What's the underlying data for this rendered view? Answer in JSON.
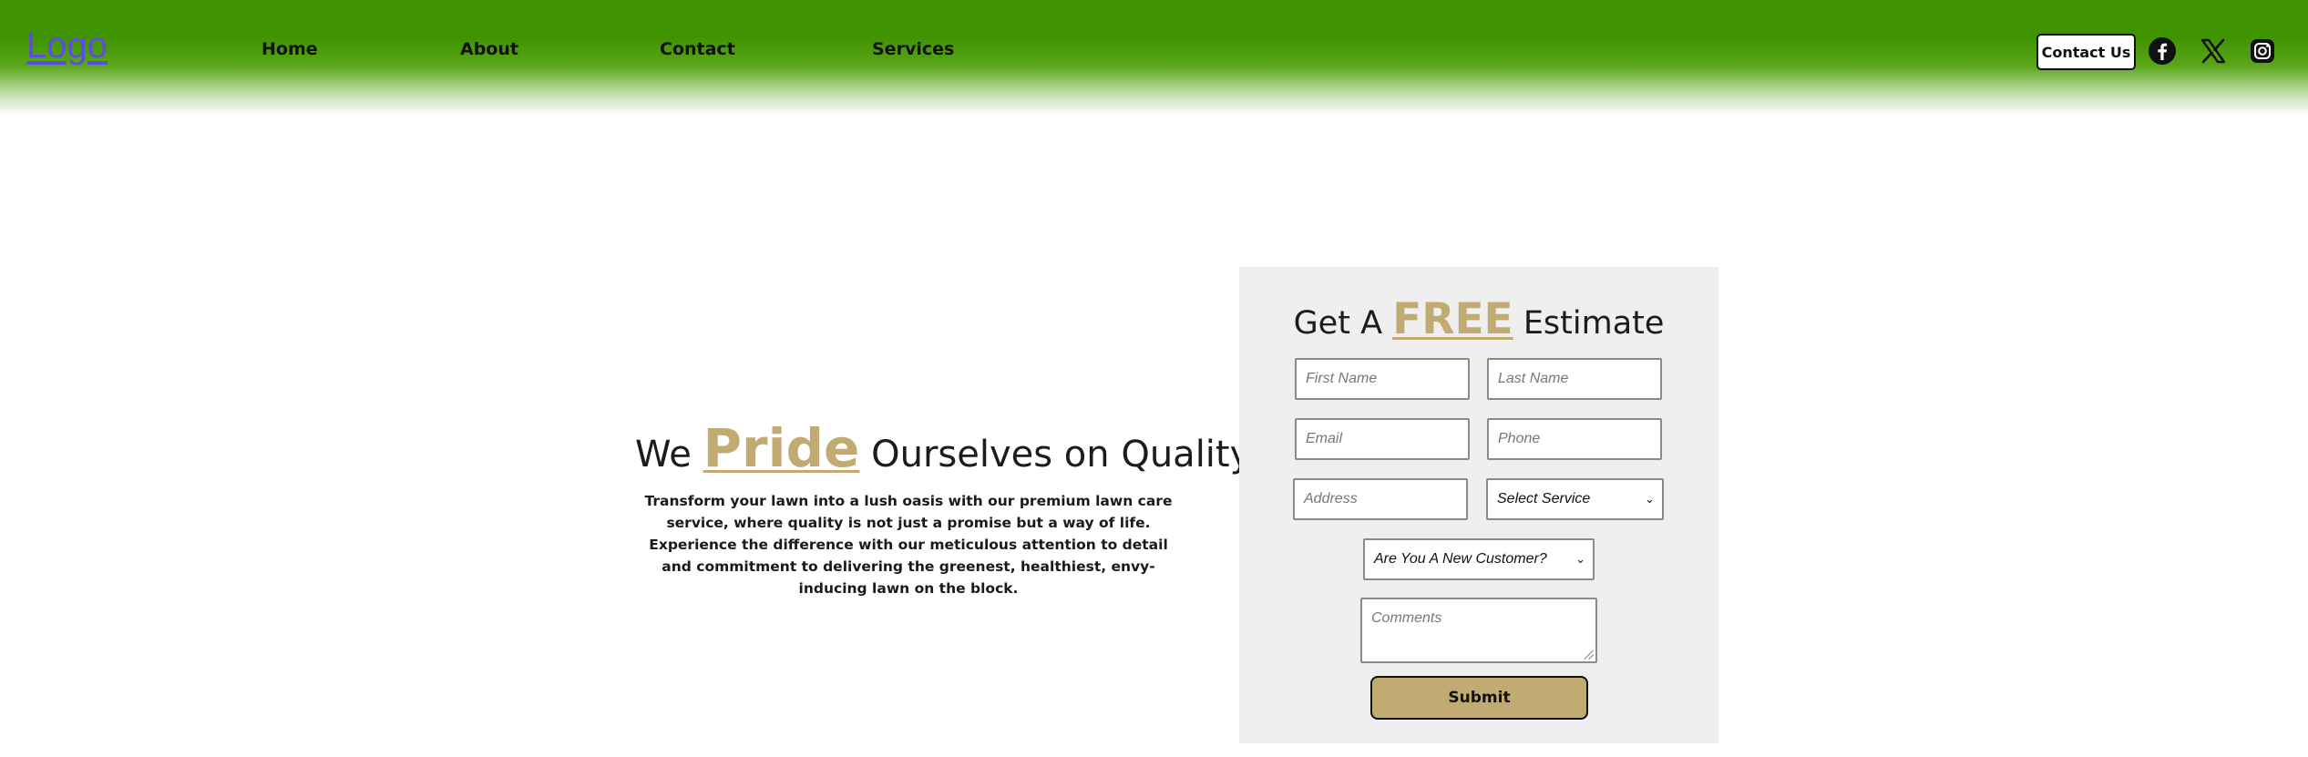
{
  "header": {
    "logo": "Logo",
    "nav": [
      "Home",
      "About",
      "Contact",
      "Services"
    ],
    "contact_button": "Contact Us",
    "social_icons": [
      "facebook-icon",
      "x-icon",
      "instagram-icon"
    ]
  },
  "hero": {
    "title_before": "We",
    "title_accent": "Pride",
    "title_after": "Ourselves on Quality.",
    "description": "Transform your lawn into a lush oasis with our premium lawn care service, where quality is not just a promise but a way of life. Experience the difference with our meticulous attention to detail and commitment to delivering the greenest, healthiest, envy-inducing lawn on the block."
  },
  "form": {
    "title_before": "Get A",
    "title_accent": "FREE",
    "title_after": "Estimate",
    "first_name_placeholder": "First Name",
    "last_name_placeholder": "Last Name",
    "email_placeholder": "Email",
    "phone_placeholder": "Phone",
    "address_placeholder": "Address",
    "service_select": "Select Service",
    "customer_select": "Are You A New Customer?",
    "comments_placeholder": "Comments",
    "submit_label": "Submit"
  },
  "colors": {
    "header_green": "#3f9200",
    "accent_gold": "#c2ab72",
    "form_panel": "#efefef",
    "logo_link": "#5a4fe0"
  }
}
